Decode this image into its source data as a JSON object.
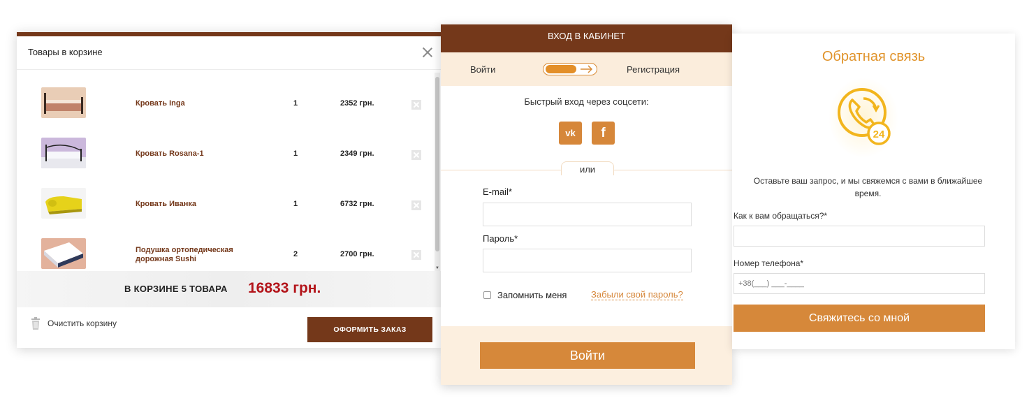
{
  "cart": {
    "title": "Товары в корзине",
    "items": [
      {
        "name": "Кровать Inga",
        "qty": "1",
        "price": "2352 грн.",
        "thumb_color": "#c89a7a"
      },
      {
        "name": "Кровать Rosana-1",
        "qty": "1",
        "price": "2349 грн.",
        "thumb_color": "#b8a6c7"
      },
      {
        "name": "Кровать Иванка",
        "qty": "1",
        "price": "6732 грн.",
        "thumb_color": "#e8d400"
      },
      {
        "name": "Подушка ортопедическая дорожная Sushi",
        "qty": "2",
        "price": "2700 грн.",
        "thumb_color": "#d9a58c"
      }
    ],
    "total_label": "В КОРЗИНЕ  5  ТОВАРА",
    "total_sum": "16833 грн.",
    "clear_label": "Очистить корзину",
    "order_label": "ОФОРМИТЬ ЗАКАЗ"
  },
  "login": {
    "header": "ВХОД В КАБИНЕТ",
    "tab_login": "Войти",
    "tab_register": "Регистрация",
    "social_title": "Быстрый вход через соцсети:",
    "vk_label": "vk",
    "fb_label": "f",
    "or_label": "или",
    "email_label": "E-mail*",
    "password_label": "Пароль*",
    "remember_label": "Запомнить меня",
    "forgot_label": "Забыли свой пароль?",
    "submit_label": "Войти"
  },
  "feedback": {
    "title": "Обратная связь",
    "badge": "24",
    "description": "Оставьте ваш запрос, и мы свяжемся с вами в ближайшее время.",
    "name_label": "Как к вам обращаться?*",
    "phone_label": "Номер телефона*",
    "phone_placeholder": "+38(___) ___-____",
    "submit_label": "Свяжитесь со мной"
  },
  "colors": {
    "brown": "#74381a",
    "orange": "#d6883a",
    "red_total": "#b3141a",
    "cream": "#fbeddc"
  }
}
